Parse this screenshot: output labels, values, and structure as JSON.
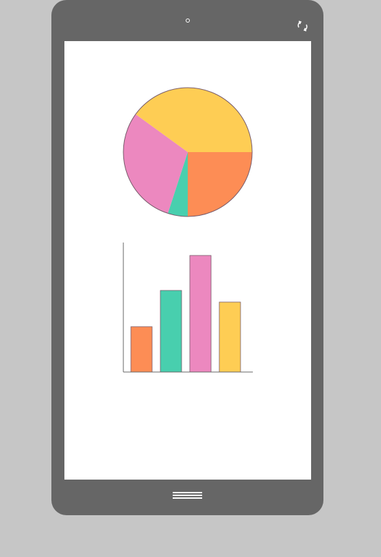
{
  "device": {
    "camera_icon": "camera-dot",
    "rotate_icon": "rotate-arrows",
    "home_icon": "menu-lines"
  },
  "chart_data": [
    {
      "type": "pie",
      "slices": [
        {
          "value": 25,
          "color": "#fd8d55"
        },
        {
          "value": 5,
          "color": "#48cfae"
        },
        {
          "value": 30,
          "color": "#ec88bf"
        },
        {
          "value": 40,
          "color": "#fecd54"
        }
      ],
      "start_angle_deg": 0,
      "direction": "clockwise",
      "stroke": "#775a6a"
    },
    {
      "type": "bar",
      "categories": [
        "",
        "",
        "",
        ""
      ],
      "values": [
        35,
        63,
        90,
        54
      ],
      "colors": [
        "#fd8d55",
        "#48cfae",
        "#ec88bf",
        "#fecd54"
      ],
      "ylim": [
        0,
        100
      ],
      "axis_color": "#666666"
    }
  ]
}
